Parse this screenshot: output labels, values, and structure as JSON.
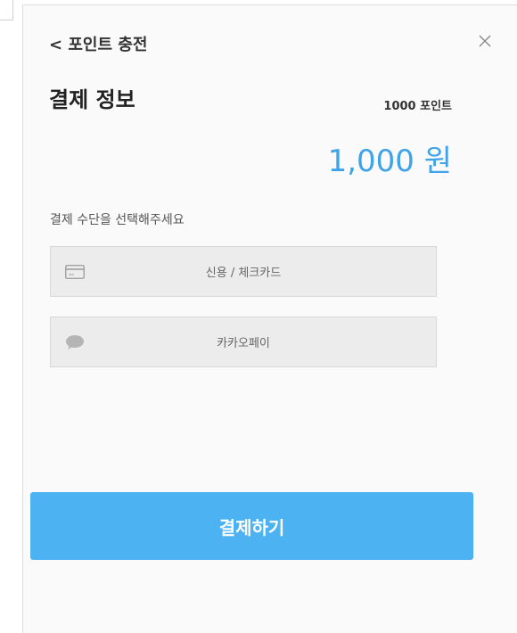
{
  "header": {
    "back_label": "< 포인트 충전",
    "close_icon": "close-icon"
  },
  "payment_info": {
    "title": "결제 정보",
    "points": "1000 포인트",
    "price": "1,000 원"
  },
  "methods": {
    "prompt": "결제 수단을 선택해주세요",
    "items": [
      {
        "label": "신용 / 체크카드",
        "icon": "credit-card-icon"
      },
      {
        "label": "카카오페이",
        "icon": "chat-bubble-icon"
      }
    ]
  },
  "submit": {
    "label": "결제하기"
  },
  "colors": {
    "accent": "#3ea3e8",
    "button": "#4db2f2",
    "method_bg": "#ececec"
  }
}
